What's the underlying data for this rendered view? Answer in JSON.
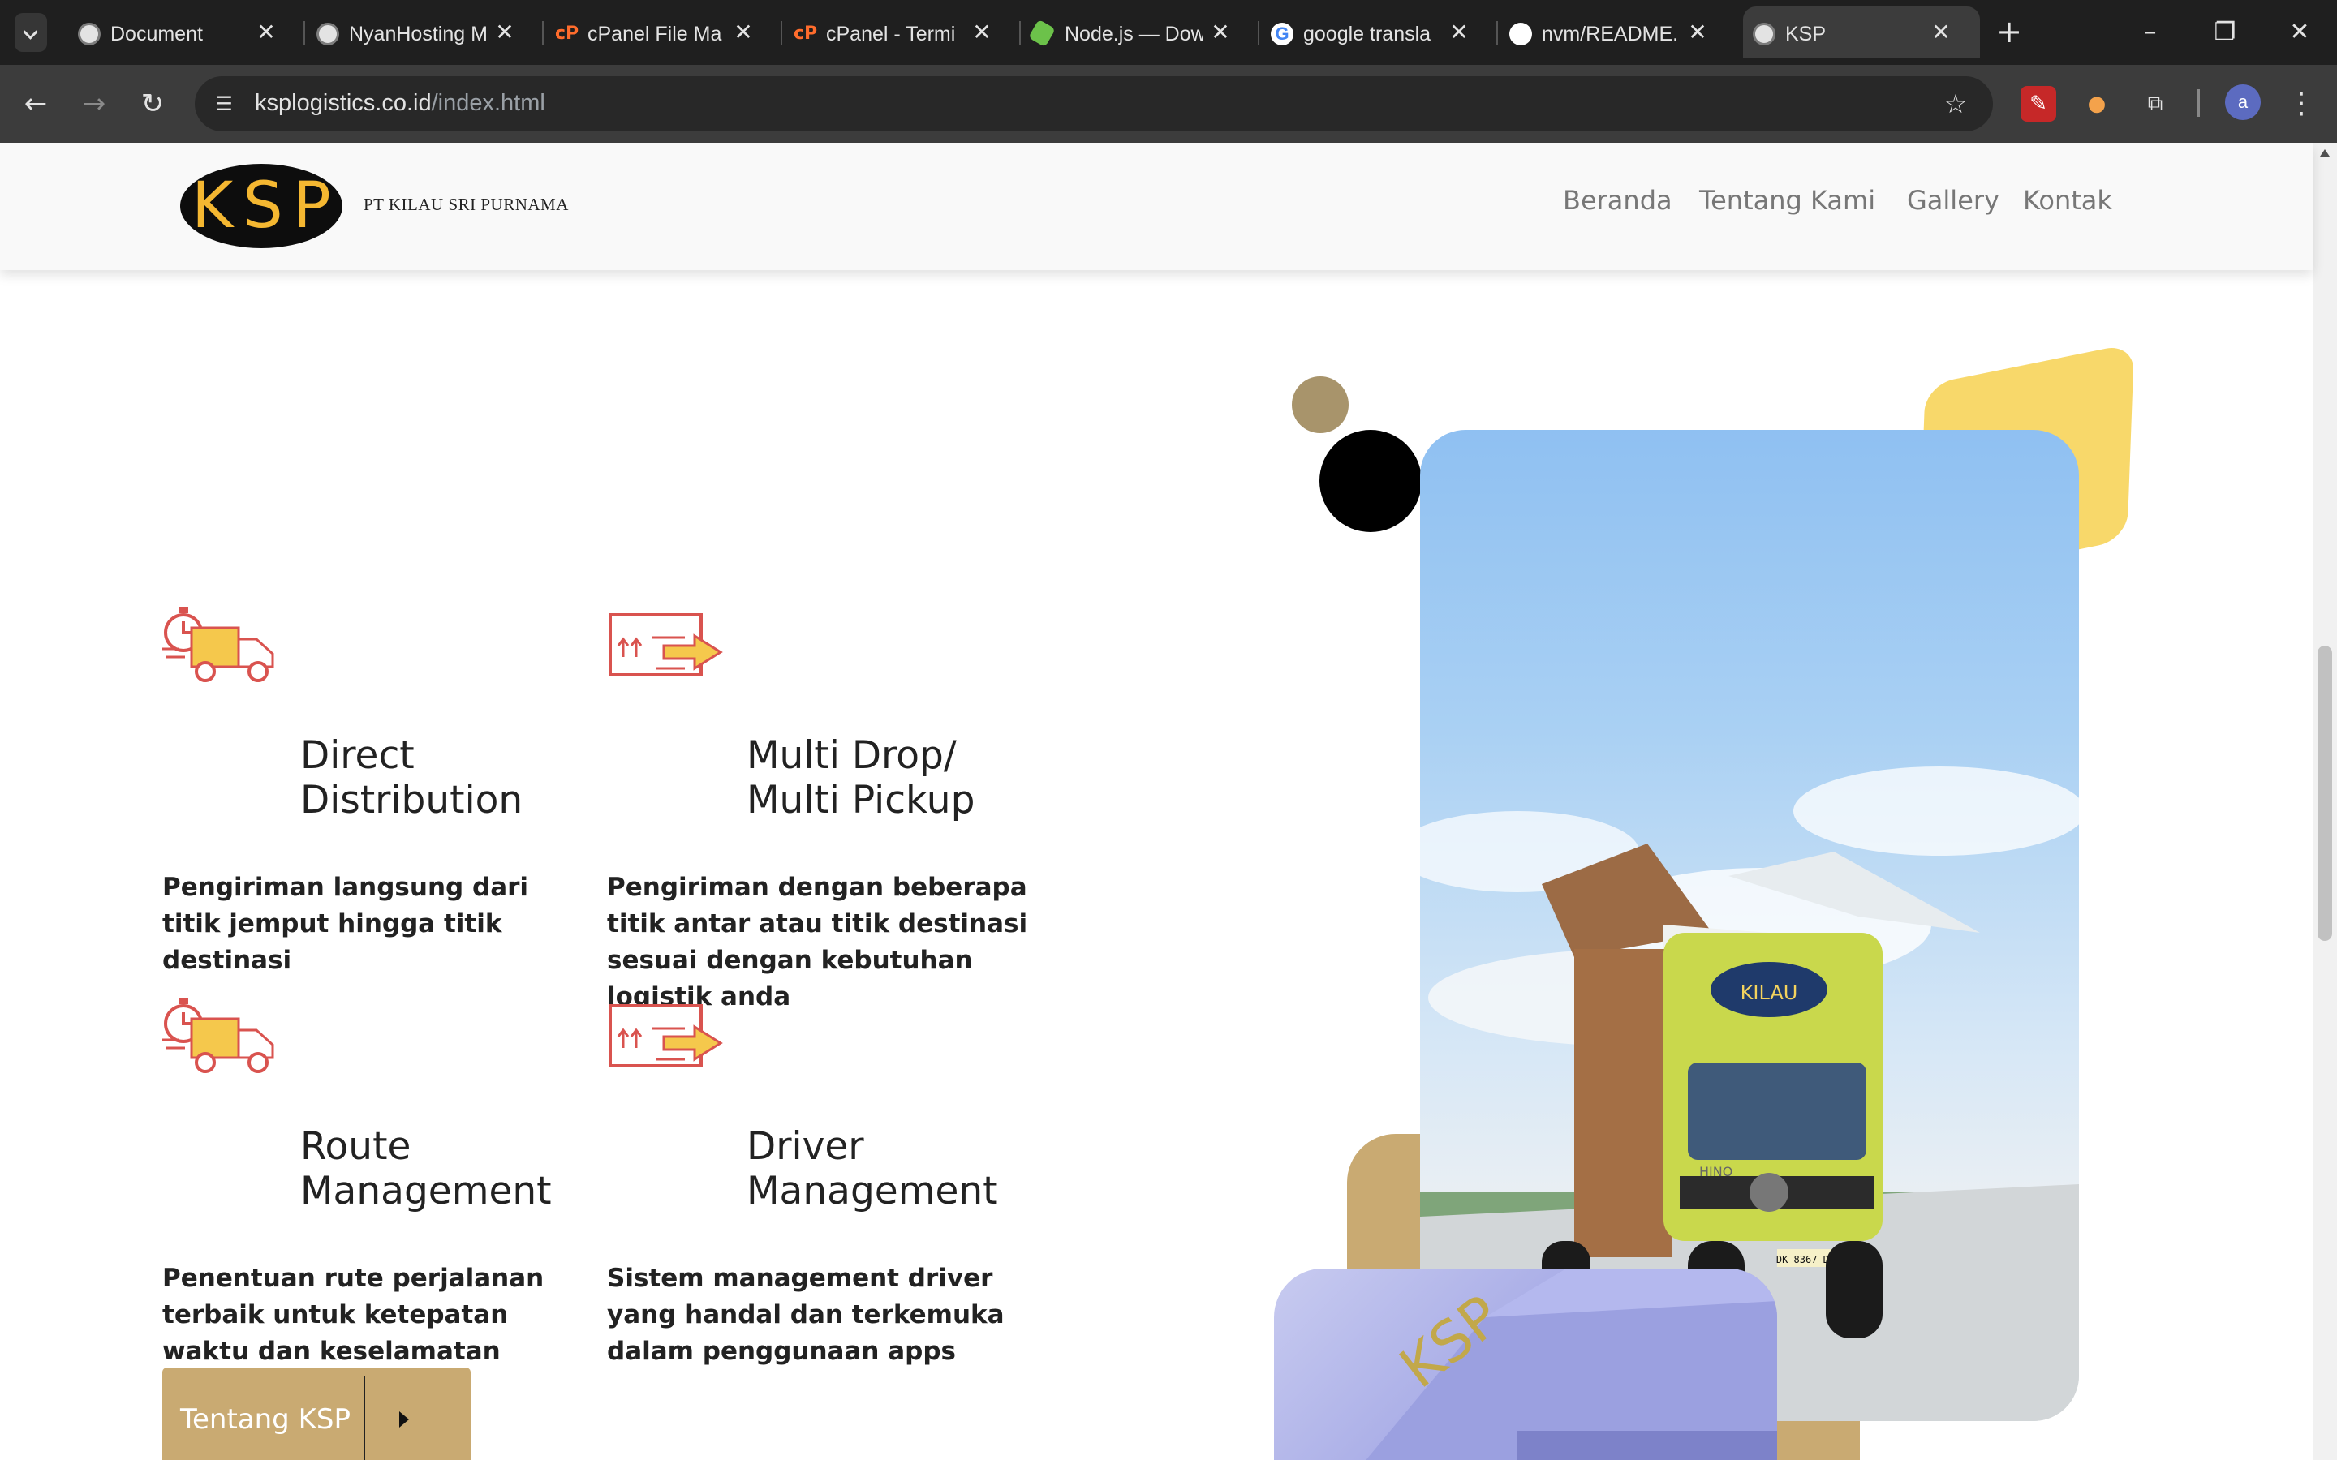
{
  "browser": {
    "tabs": [
      {
        "title": "Document",
        "favicon": "globe-icon"
      },
      {
        "title": "NyanHosting M",
        "favicon": "globe-icon"
      },
      {
        "title": "cPanel File Ma",
        "favicon": "cpanel-icon"
      },
      {
        "title": "cPanel - Termi",
        "favicon": "cpanel-icon"
      },
      {
        "title": "Node.js — Dow",
        "favicon": "nodejs-icon"
      },
      {
        "title": "google transla",
        "favicon": "google-icon"
      },
      {
        "title": "nvm/README.",
        "favicon": "github-icon"
      },
      {
        "title": "KSP",
        "favicon": "globe-icon",
        "active": true
      }
    ],
    "address": {
      "domain": "ksplogistics.co.id",
      "path": "/index.html"
    },
    "profile_initial": "a"
  },
  "site": {
    "logo_text": "KSP",
    "company_name": "PT KILAU SRI PURNAMA",
    "nav": [
      "Beranda",
      "Tentang Kami",
      "Gallery",
      "Kontak"
    ]
  },
  "services": [
    {
      "title_line1": "Direct",
      "title_line2": "Distribution",
      "icon": "delivery-truck-icon",
      "description": "Pengiriman langsung dari titik jemput hingga titik destinasi"
    },
    {
      "title_line1": "Multi Drop/",
      "title_line2": "Multi Pickup",
      "icon": "package-transfer-icon",
      "description": "Pengiriman dengan beberapa titik antar atau titik destinasi sesuai dengan kebutuhan logistik anda"
    },
    {
      "title_line1": "Route",
      "title_line2": "Management",
      "icon": "delivery-truck-icon",
      "description": "Penentuan rute perjalanan terbaik untuk ketepatan waktu dan keselamatan pengiriman"
    },
    {
      "title_line1": "Driver",
      "title_line2": "Management",
      "icon": "package-transfer-icon",
      "description": "Sistem management driver yang handal dan terkemuka dalam penggunaan apps"
    }
  ],
  "cta": {
    "label": "Tentang KSP"
  },
  "photo": {
    "truck_brand": "KILAU",
    "truck_model": "HINO",
    "plate": "DK 8367 DO"
  },
  "photo_small": {
    "text": "KSP"
  },
  "colors": {
    "accent_tan": "#c9aa72",
    "accent_yellow": "#f8d86a",
    "icon_red": "#d9534f",
    "icon_yellow": "#f5c84c"
  }
}
